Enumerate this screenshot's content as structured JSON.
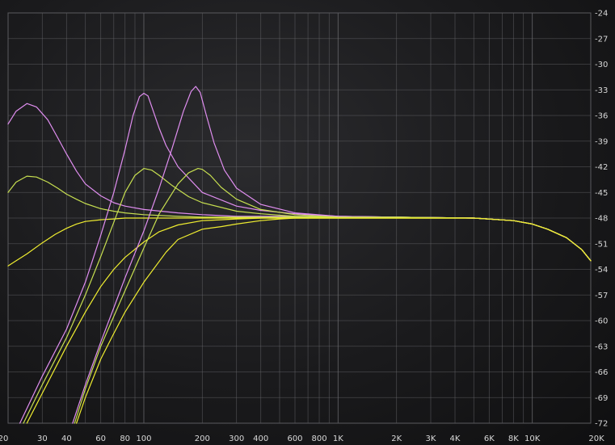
{
  "chart_data": {
    "type": "line",
    "title": "",
    "xlabel": "",
    "ylabel": "",
    "x_scale": "log",
    "xlim": [
      20,
      20000
    ],
    "ylim": [
      -72,
      -24
    ],
    "grid": true,
    "x_ticks": [
      {
        "v": 20,
        "label": "20"
      },
      {
        "v": 30,
        "label": "30"
      },
      {
        "v": 40,
        "label": "40"
      },
      {
        "v": 60,
        "label": "60"
      },
      {
        "v": 80,
        "label": "80"
      },
      {
        "v": 100,
        "label": "100"
      },
      {
        "v": 200,
        "label": "200"
      },
      {
        "v": 300,
        "label": "300"
      },
      {
        "v": 400,
        "label": "400"
      },
      {
        "v": 600,
        "label": "600"
      },
      {
        "v": 800,
        "label": "800"
      },
      {
        "v": 1000,
        "label": "1K"
      },
      {
        "v": 2000,
        "label": "2K"
      },
      {
        "v": 3000,
        "label": "3K"
      },
      {
        "v": 4000,
        "label": "4K"
      },
      {
        "v": 6000,
        "label": "6K"
      },
      {
        "v": 8000,
        "label": "8K"
      },
      {
        "v": 10000,
        "label": "10K"
      },
      {
        "v": 20000,
        "label": "20K"
      }
    ],
    "y_ticks": [
      {
        "v": -24,
        "label": "-24"
      },
      {
        "v": -27,
        "label": "-27"
      },
      {
        "v": -30,
        "label": "-30"
      },
      {
        "v": -33,
        "label": "-33"
      },
      {
        "v": -36,
        "label": "-36"
      },
      {
        "v": -39,
        "label": "-39"
      },
      {
        "v": -42,
        "label": "-42"
      },
      {
        "v": -45,
        "label": "-45"
      },
      {
        "v": -48,
        "label": "-48"
      },
      {
        "v": -51,
        "label": "-51"
      },
      {
        "v": -54,
        "label": "-54"
      },
      {
        "v": -57,
        "label": "-57"
      },
      {
        "v": -60,
        "label": "-60"
      },
      {
        "v": -63,
        "label": "-63"
      },
      {
        "v": -66,
        "label": "-66"
      },
      {
        "v": -69,
        "label": "-69"
      },
      {
        "v": -72,
        "label": "-72"
      }
    ],
    "colors": {
      "magenta": "#e08ef0",
      "green": "#c8e050",
      "yellow": "#f0ee30",
      "background": "#1c1c1e",
      "text": "#d8d8d8"
    },
    "series": [
      {
        "color": "magenta",
        "x": [
          20,
          22,
          25,
          28,
          32,
          36,
          40,
          45,
          50,
          60,
          70,
          80,
          100,
          150,
          200,
          300,
          400,
          600,
          1000,
          2000,
          5000,
          8000,
          10000,
          12000,
          15000,
          18000,
          20000
        ],
        "y": [
          -37,
          -35.5,
          -34.6,
          -35,
          -36.5,
          -38.6,
          -40.5,
          -42.5,
          -44,
          -45.4,
          -46.2,
          -46.6,
          -47,
          -47.4,
          -47.6,
          -47.8,
          -47.8,
          -47.8,
          -47.8,
          -47.9,
          -48,
          -48.3,
          -48.7,
          -49.3,
          -50.3,
          -51.7,
          -53
        ]
      },
      {
        "color": "green",
        "x": [
          20,
          22,
          25,
          28,
          32,
          36,
          40,
          45,
          50,
          60,
          70,
          80,
          100,
          150,
          200,
          300,
          400,
          600,
          1000,
          2000,
          5000,
          8000,
          10000,
          12000,
          15000,
          18000,
          20000
        ],
        "y": [
          -45,
          -43.8,
          -43.1,
          -43.2,
          -43.8,
          -44.5,
          -45.2,
          -45.8,
          -46.3,
          -46.9,
          -47.2,
          -47.4,
          -47.6,
          -47.8,
          -47.9,
          -47.9,
          -47.9,
          -47.9,
          -47.9,
          -47.9,
          -48,
          -48.3,
          -48.7,
          -49.3,
          -50.3,
          -51.7,
          -53
        ]
      },
      {
        "color": "yellow",
        "x": [
          20,
          22,
          25,
          30,
          35,
          40,
          45,
          50,
          60,
          70,
          80,
          100,
          150,
          200,
          300,
          400,
          600,
          1000,
          2000,
          5000,
          8000,
          10000,
          12000,
          15000,
          18000,
          20000
        ],
        "y": [
          -53.6,
          -53,
          -52.2,
          -50.9,
          -49.9,
          -49.2,
          -48.7,
          -48.4,
          -48.2,
          -48.1,
          -48,
          -48,
          -48,
          -48,
          -48,
          -48,
          -48,
          -48,
          -48,
          -48,
          -48.3,
          -48.7,
          -49.3,
          -50.3,
          -51.7,
          -53
        ]
      },
      {
        "color": "magenta",
        "x": [
          23,
          30,
          40,
          50,
          60,
          70,
          80,
          88,
          95,
          100,
          105,
          110,
          120,
          130,
          150,
          200,
          300,
          400,
          600,
          1000,
          2000,
          5000,
          8000,
          10000,
          12000,
          15000,
          18000,
          20000
        ],
        "y": [
          -72,
          -66.5,
          -61,
          -55.5,
          -50,
          -45,
          -40,
          -36,
          -33.8,
          -33.4,
          -33.7,
          -35,
          -37.5,
          -39.5,
          -42,
          -45,
          -46.6,
          -47.1,
          -47.5,
          -47.8,
          -47.9,
          -48,
          -48.3,
          -48.7,
          -49.3,
          -50.3,
          -51.7,
          -53
        ]
      },
      {
        "color": "green",
        "x": [
          24,
          30,
          40,
          50,
          60,
          70,
          80,
          90,
          100,
          110,
          120,
          140,
          170,
          200,
          300,
          400,
          600,
          1000,
          2000,
          5000,
          8000,
          10000,
          12000,
          15000,
          18000,
          20000
        ],
        "y": [
          -72,
          -67.5,
          -62,
          -57,
          -52.5,
          -48.5,
          -45,
          -43,
          -42.2,
          -42.4,
          -43,
          -44.2,
          -45.5,
          -46.2,
          -47.2,
          -47.5,
          -47.8,
          -47.9,
          -47.9,
          -48,
          -48.3,
          -48.7,
          -49.3,
          -50.3,
          -51.7,
          -53
        ]
      },
      {
        "color": "yellow",
        "x": [
          25,
          30,
          40,
          50,
          60,
          70,
          80,
          100,
          120,
          150,
          200,
          250,
          300,
          400,
          500,
          600,
          1000,
          2000,
          5000,
          8000,
          10000,
          12000,
          15000,
          18000,
          20000
        ],
        "y": [
          -72,
          -68.5,
          -63,
          -59,
          -56,
          -54,
          -52.6,
          -50.8,
          -49.6,
          -48.8,
          -48.3,
          -48.2,
          -48.1,
          -48,
          -48,
          -48,
          -48,
          -48,
          -48,
          -48.3,
          -48.7,
          -49.3,
          -50.3,
          -51.7,
          -53
        ]
      },
      {
        "color": "magenta",
        "x": [
          43,
          50,
          60,
          70,
          80,
          100,
          120,
          140,
          160,
          175,
          185,
          195,
          210,
          230,
          260,
          300,
          400,
          600,
          1000,
          2000,
          5000,
          8000,
          10000,
          12000,
          15000,
          18000,
          20000
        ],
        "y": [
          -72,
          -67.5,
          -62.5,
          -58.5,
          -55,
          -49.5,
          -44.5,
          -39.8,
          -35.5,
          -33.2,
          -32.6,
          -33.3,
          -36,
          -39.2,
          -42.4,
          -44.5,
          -46.4,
          -47.4,
          -47.8,
          -47.9,
          -48,
          -48.3,
          -48.7,
          -49.3,
          -50.3,
          -51.7,
          -53
        ]
      },
      {
        "color": "green",
        "x": [
          44,
          50,
          60,
          70,
          80,
          100,
          120,
          150,
          170,
          190,
          200,
          220,
          250,
          300,
          400,
          600,
          1000,
          2000,
          5000,
          8000,
          10000,
          12000,
          15000,
          18000,
          20000
        ],
        "y": [
          -72,
          -68,
          -63,
          -59.5,
          -56.5,
          -51.5,
          -47.5,
          -44,
          -42.7,
          -42.2,
          -42.3,
          -43,
          -44.4,
          -45.8,
          -47,
          -47.6,
          -47.9,
          -47.9,
          -48,
          -48.3,
          -48.7,
          -49.3,
          -50.3,
          -51.7,
          -53
        ]
      },
      {
        "color": "yellow",
        "x": [
          45,
          50,
          60,
          70,
          80,
          100,
          130,
          150,
          200,
          250,
          300,
          400,
          500,
          600,
          1000,
          2000,
          5000,
          8000,
          10000,
          12000,
          15000,
          18000,
          20000
        ],
        "y": [
          -72,
          -69,
          -64.5,
          -61.5,
          -59,
          -55.5,
          -52,
          -50.5,
          -49.3,
          -49,
          -48.7,
          -48.3,
          -48.1,
          -48,
          -48,
          -48,
          -48,
          -48.3,
          -48.7,
          -49.3,
          -50.3,
          -51.7,
          -53
        ]
      }
    ]
  }
}
